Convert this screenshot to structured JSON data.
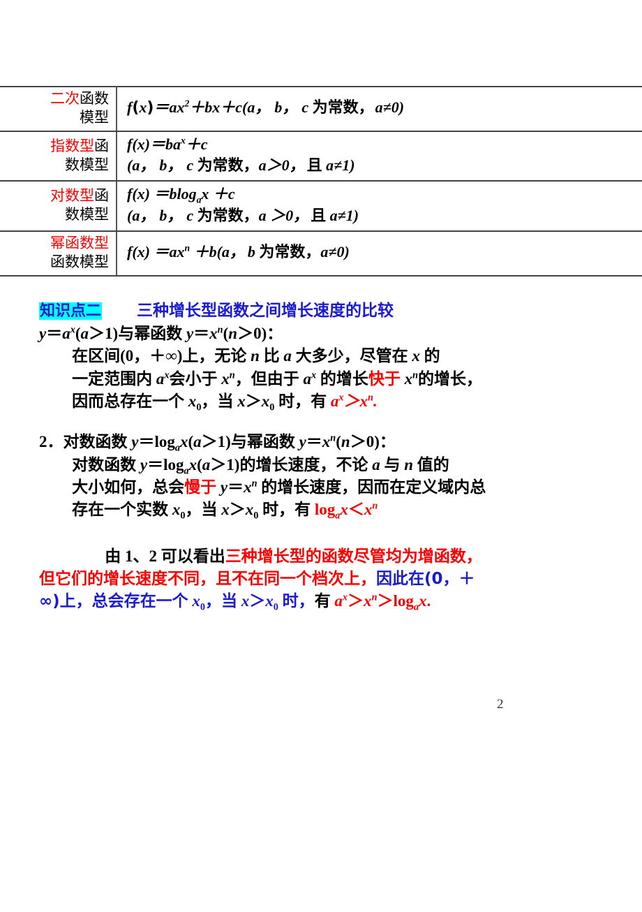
{
  "page": {
    "number": "2"
  },
  "table": {
    "rows": [
      {
        "name_red": "二次",
        "name_black": "函数",
        "name_line2": "模型",
        "formula_lines": [
          "f(x)＝ax2＋bx＋c(a，b，c 为常数，a≠0)"
        ],
        "formula_plain": "f(x)=ax²+bx+c(a, b, c 为常数, a≠0)"
      },
      {
        "name_red": "指数型",
        "name_black": "函",
        "name_line2": "数模型",
        "formula_lines": [
          "f(x)＝bax＋c",
          "(a，b，c 为常数，a＞0，且 a≠1)"
        ],
        "formula_plain": "f(x)=baˣ+c ; (a, b, c 为常数, a>0, 且 a≠1)"
      },
      {
        "name_red": "对数型",
        "name_black": "函",
        "name_line2": "数模型",
        "formula_lines": [
          "f(x) ＝blogax ＋c",
          "(a，b，c 为常数，a ＞0，且 a≠1)"
        ],
        "formula_plain": "f(x) =blogₐx +c ; (a, b, c 为常数, a >0, 且 a≠1)"
      },
      {
        "name_red": "幂函数型",
        "name_black": "",
        "name_line2": "函数模型",
        "formula_lines": [
          "f(x) ＝axn ＋b(a，b 为常数，a≠0)"
        ],
        "formula_plain": "f(x) =axⁿ +b(a, b 为常数, a≠0)"
      }
    ]
  },
  "section": {
    "badge": "知识点二",
    "title": "三种增长型函数之间增长速度的比较",
    "item1": {
      "header_a": "y＝a",
      "header_b": "(a＞1)与幂函数 y＝x",
      "header_c": "(n＞0)：",
      "header_plain": "y=aˣ(a>1)与幂函数 y=xⁿ(n>0)：",
      "body_plain": "在区间(0，＋∞)上，无论 n 比 a 大多少，尽管在 x 的一定范围内 aˣ 会小于 xⁿ，但由于 aˣ 的增长快于 xⁿ 的增长，因而总存在一个 x₀，当 x＞x₀ 时，有 aˣ＞xⁿ.",
      "seg_1": "在区间(0，＋∞)上，无论 ",
      "seg_2": "n",
      "seg_3": " 比 ",
      "seg_4": "a",
      "seg_5": " 大多少，尽管在 ",
      "seg_6": "x",
      "seg_7": " 的",
      "seg_8": "一定范围内 ",
      "seg_9": "会小于 ",
      "seg_10": "，但由于 ",
      "seg_11": " 的增长",
      "seg_red_1": "快于",
      "seg_12": " 的增长，",
      "seg_13": "因而总存在一个 ",
      "seg_14": "，当 ",
      "seg_15": " 时，有 ",
      "seg_red_2_a": "a",
      "seg_red_2_b": "＞",
      "seg_red_2_c": ".",
      "sup_x": "x",
      "sup_n": "n",
      "sub_0": "0",
      "var_x": "x",
      "var_a": "a",
      "var_x0_pre": "x"
    },
    "item2": {
      "num": "2．",
      "header_plain": "对数函数 y=logₐx(a>1)与幂函数 y=xⁿ(n>0)：",
      "h_1": "对数函数 ",
      "h_2": "y＝log",
      "h_3": "x(a＞1)与幂函数 ",
      "h_4": "y＝x",
      "h_5": "(n＞0)：",
      "body_plain": "对数函数 y=logₐx(a>1)的增长速度，不论 a 与 n 值的大小如何，总会慢于 y=xⁿ 的增长速度，因而在定义域内总存在一个实数 x₀，当 x>x₀ 时，有 logₐx<xⁿ",
      "b_1": "对数函数 ",
      "b_2": "y＝log",
      "b_3": "x(a＞1)的增长速度，不论 ",
      "b_4": " 与 ",
      "b_5": " 值的",
      "b_6": "大小如何，总会",
      "b_red": "慢于",
      "b_7": "y＝x",
      "b_8": " 的增长速度，因而在定义域内总",
      "b_9": "存在一个实数 ",
      "b_10": "，当 ",
      "b_11": " 时，有 ",
      "b_red2_1": "log",
      "b_red2_2": "x＜x"
    },
    "conclusion": {
      "plain": "由 1、2 可以看出三种增长型的函数尽管均为增函数，但它们的增长速度不同，且不在同一个档次上，因此在(0，＋∞)上，总会存在一个 x₀，当 x＞x₀ 时，有 aˣ＞xⁿ＞logₐx.",
      "c_black_1": "由 ",
      "c_black_n1": "1",
      "c_black_2": "、",
      "c_black_n2": "2",
      "c_black_3": " 可以看出",
      "c_red_1": "三种增长型的函数尽管均为增函数，",
      "c_red_2": "但它们的增长速度不同，且不在同一个档次上，",
      "c_blue_1": "因此在(0，＋",
      "c_blue_2": "∞)上，总会存在一个 ",
      "c_blue_3": "，当 ",
      "c_blue_4": " 时，",
      "c_black_4": "有 ",
      "c_red_3a": "a",
      "c_red_3b": "＞",
      "c_red_3c": "＞log",
      "c_red_3d": "x."
    }
  },
  "colors": {
    "red": "#ff0000",
    "blue": "#1a1ad0",
    "highlight": "#00ffff",
    "rule": "#444444"
  }
}
